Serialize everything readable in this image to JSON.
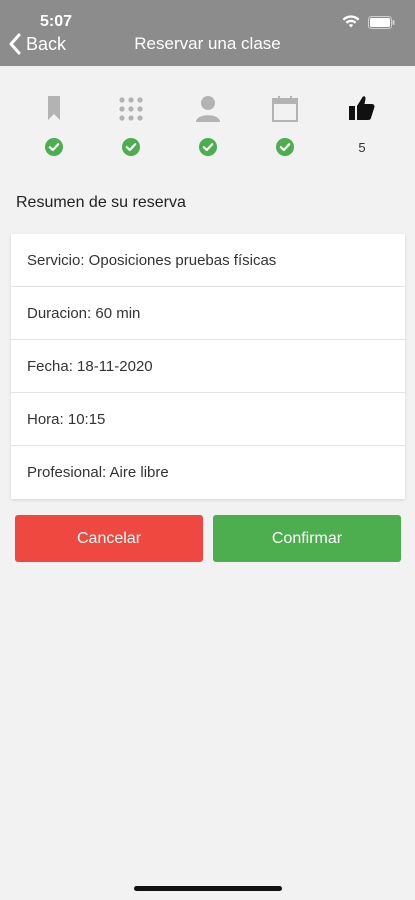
{
  "status_bar": {
    "time": "5:07"
  },
  "header": {
    "back_label": "Back",
    "title": "Reservar una clase"
  },
  "steps": [
    {
      "icon": "bookmark-icon",
      "status": "done"
    },
    {
      "icon": "grid-icon",
      "status": "done"
    },
    {
      "icon": "person-icon",
      "status": "done"
    },
    {
      "icon": "calendar-icon",
      "status": "done"
    },
    {
      "icon": "thumbs-up-icon",
      "status": "current",
      "number": "5"
    }
  ],
  "summary": {
    "title": "Resumen de su reserva",
    "rows": [
      "Servicio: Oposiciones pruebas físicas",
      "Duracion: 60 min",
      "Fecha: 18-11-2020",
      "Hora: 10:15",
      "Profesional: Aire libre"
    ]
  },
  "actions": {
    "cancel_label": "Cancelar",
    "confirm_label": "Confirmar"
  },
  "colors": {
    "header": "#8c8c8c",
    "check": "#4cae4f",
    "cancel": "#ef4840",
    "confirm": "#4cae4f",
    "icon_gray": "#b3b3b3"
  }
}
